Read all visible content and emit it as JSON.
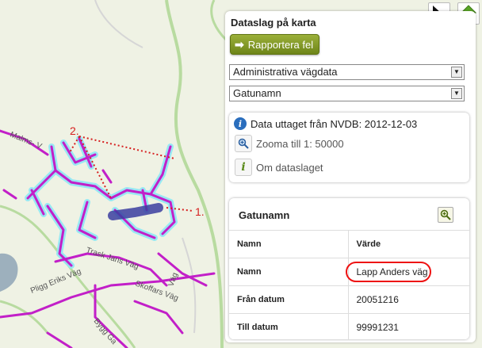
{
  "toolbar": {
    "info_tool_icon": "info-cursor-icon",
    "up_tool_icon": "green-up-arrow-icon"
  },
  "panel": {
    "title": "Dataslag på karta",
    "report_button": "Rapportera fel",
    "select_1": "Administrativa vägdata",
    "select_2": "Gatunamn"
  },
  "info": {
    "source_text": "Data uttaget från NVDB: 2012-12-03",
    "zoom_text": "Zooma till 1: 50000",
    "about_text": "Om dataslaget"
  },
  "result": {
    "title": "Gatunamn",
    "col_name": "Namn",
    "col_value": "Värde",
    "rows": [
      {
        "key": "Namn",
        "value": "Lapp Anders väg"
      },
      {
        "key": "Från datum",
        "value": "20051216"
      },
      {
        "key": "Till datum",
        "value": "99991231"
      }
    ]
  },
  "map": {
    "annotation_1": "1.",
    "annotation_2": "2.",
    "road_labels": [
      "Malms- V",
      "Trask Jans Väg",
      "Pligg Eriks Väg",
      "Skoffars Väg",
      "Bygg Ga",
      "Väg"
    ],
    "highlight_color": "#3b3ea0",
    "road_color": "#c21fc8",
    "glow_color": "#8fe8f5"
  }
}
